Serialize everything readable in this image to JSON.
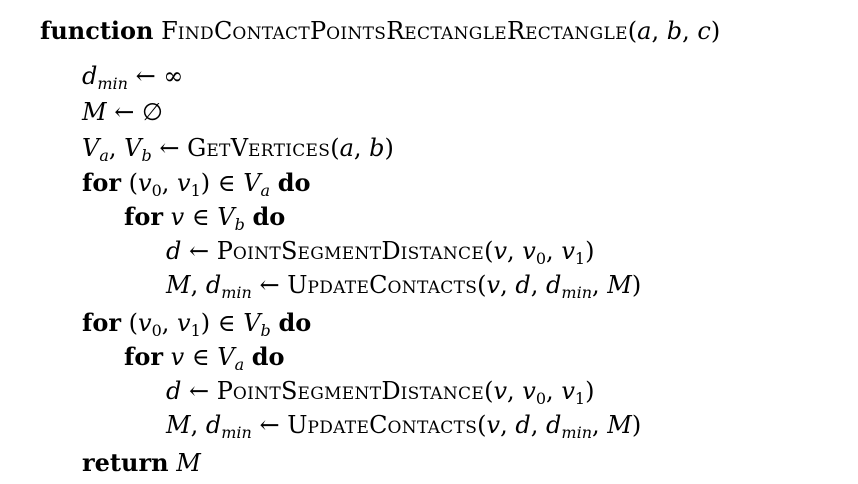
{
  "algorithm": {
    "header": {
      "keyword": "function",
      "name": "FindContactPointsRectangleRectangle",
      "params": "(a, b, c)"
    },
    "lines": [
      {
        "indent": 1,
        "text": "d_min ← ∞"
      },
      {
        "indent": 1,
        "text": "M ← ∅"
      },
      {
        "indent": 1,
        "text": "V_a, V_b ← GetVertices(a, b)"
      },
      {
        "indent": 1,
        "text": "for (v_0, v_1) ∈ V_a do"
      },
      {
        "indent": 2,
        "text": "for v ∈ V_b do"
      },
      {
        "indent": 3,
        "text": "d ← PointSegmentDistance(v, v_0, v_1)"
      },
      {
        "indent": 3,
        "text": "M, d_min ← UpdateContacts(v, d, d_min, M)"
      },
      {
        "indent": 1,
        "text": "for (v_0, v_1) ∈ V_b do"
      },
      {
        "indent": 2,
        "text": "for v ∈ V_a do"
      },
      {
        "indent": 3,
        "text": "d ← PointSegmentDistance(v, v_0, v_1)"
      },
      {
        "indent": 3,
        "text": "M, d_min ← UpdateContacts(v, d, d_min, M)"
      },
      {
        "indent": 1,
        "text": "return M"
      }
    ],
    "keywords": {
      "for": "for",
      "do": "do",
      "return": "return"
    },
    "procedures": {
      "get_vertices": "GetVertices",
      "point_segment_distance": "PointSegmentDistance",
      "update_contacts": "UpdateContacts"
    }
  }
}
